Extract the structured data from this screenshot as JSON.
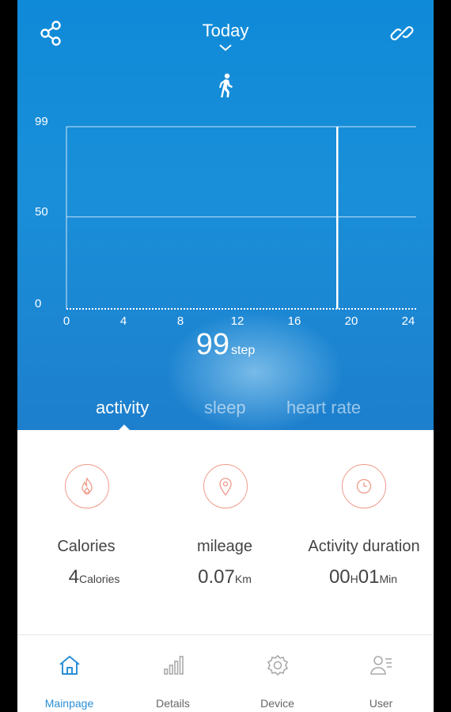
{
  "header": {
    "title": "Today",
    "share_icon": "share-icon",
    "link_icon": "link-icon",
    "activity_icon": "walking-person-icon"
  },
  "chart_data": {
    "type": "bar",
    "x_ticks": [
      "0",
      "4",
      "8",
      "12",
      "16",
      "20",
      "24"
    ],
    "y_ticks": [
      "0",
      "50",
      "99"
    ],
    "xlim": [
      0,
      24
    ],
    "ylim": [
      0,
      99
    ],
    "bars": [
      {
        "hour": 19,
        "value": 99
      }
    ],
    "grid": true
  },
  "summary": {
    "value": "99",
    "unit": "step"
  },
  "tabs": [
    {
      "label": "activity",
      "active": true
    },
    {
      "label": "sleep",
      "active": false
    },
    {
      "label": "heart rate",
      "active": false
    }
  ],
  "stats": {
    "calories": {
      "label": "Calories",
      "value": "4",
      "unit": "Calories",
      "icon": "flame-icon"
    },
    "mileage": {
      "label": "mileage",
      "value": "0.07",
      "unit": "Km",
      "icon": "location-pin-icon"
    },
    "duration": {
      "label": "Activity duration",
      "hours": "00",
      "hours_unit": "H",
      "minutes": "01",
      "minutes_unit": "Min",
      "icon": "clock-icon"
    }
  },
  "accent_color": "#ef9b8a",
  "nav": [
    {
      "label": "Mainpage",
      "icon": "home-icon",
      "active": true
    },
    {
      "label": "Details",
      "icon": "bar-chart-icon",
      "active": false
    },
    {
      "label": "Device",
      "icon": "gear-icon",
      "active": false
    },
    {
      "label": "User",
      "icon": "user-list-icon",
      "active": false
    }
  ]
}
